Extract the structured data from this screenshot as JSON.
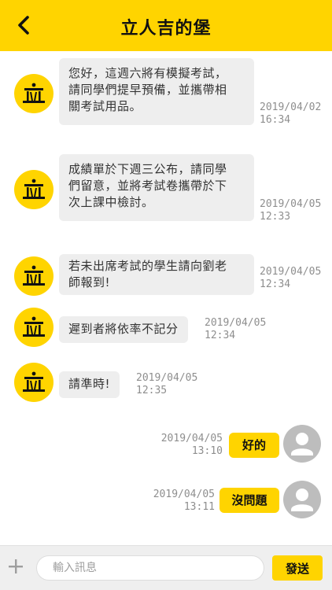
{
  "header": {
    "title": "立人吉的堡",
    "back_icon": "chevron-left-icon"
  },
  "colors": {
    "accent": "#FFD400",
    "bubble_incoming": "#EEEEEE",
    "timestamp": "#8E8E8E"
  },
  "incoming": [
    {
      "lines": [
        "您好，這週六將有模擬考試，",
        "請同學們提早預備，並攜帶相",
        "關考試用品。"
      ],
      "date": "2019/04/02",
      "time": "16:34"
    },
    {
      "lines": [
        "成績單於下週三公布，請同學",
        "們留意，並將考試卷攜帶於下",
        "次上課中檢討。"
      ],
      "date": "2019/04/05",
      "time": "12:33"
    },
    {
      "lines": [
        "若未出席考試的學生請向劉老",
        "師報到!"
      ],
      "date": "2019/04/05",
      "time": "12:34"
    },
    {
      "lines": [
        "遲到者將依率不記分"
      ],
      "date": "2019/04/05",
      "time": "12:34"
    },
    {
      "lines": [
        "請準時!"
      ],
      "date": "2019/04/05",
      "time": "12:35"
    }
  ],
  "outgoing": [
    {
      "text": "好的",
      "date": "2019/04/05",
      "time": "13:10"
    },
    {
      "text": "沒問題",
      "date": "2019/04/05",
      "time": "13:11"
    }
  ],
  "composer": {
    "plus_icon": "plus-icon",
    "placeholder": "輸入訊息",
    "value": "",
    "send_label": "發送"
  }
}
